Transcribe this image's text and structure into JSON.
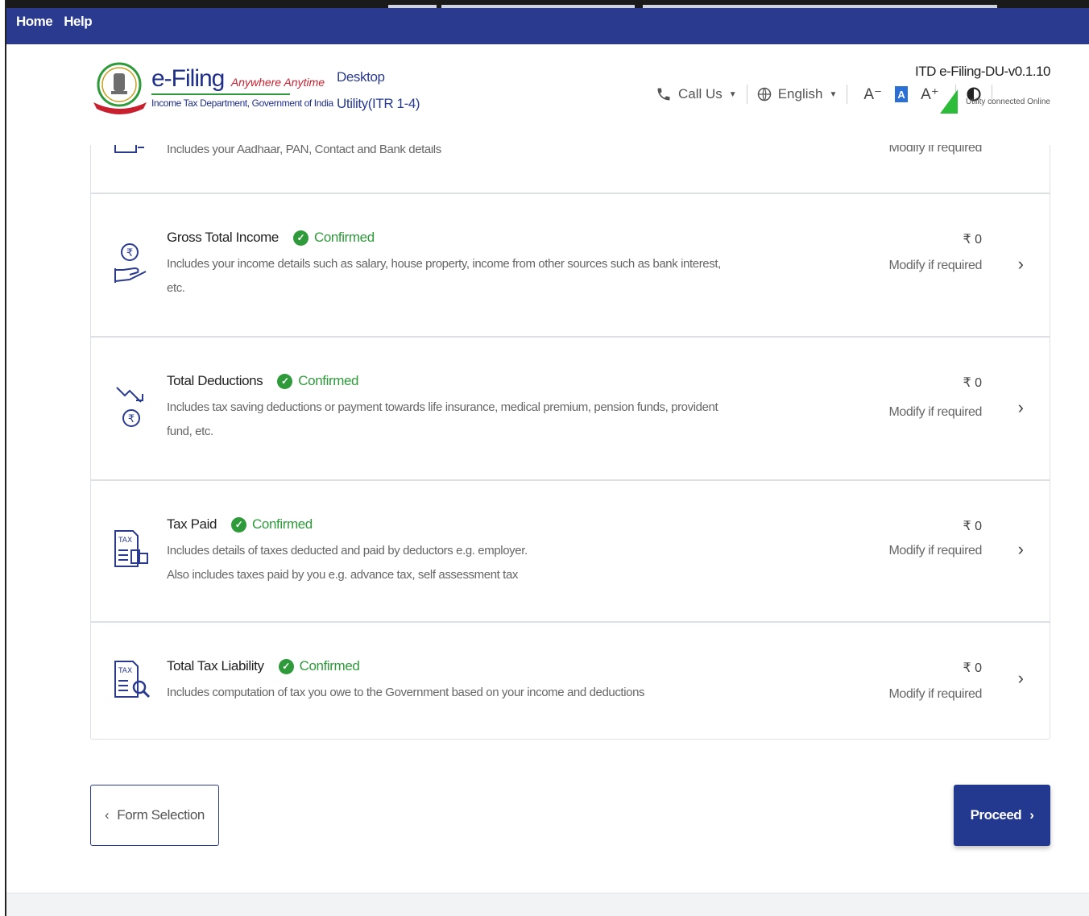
{
  "menubar": {
    "home": "Home",
    "help": "Help"
  },
  "brand": {
    "title": "e-Filing",
    "tagline": "Anywhere Anytime",
    "subtitle": "Income Tax Department, Government of India"
  },
  "app": {
    "line1": "Desktop",
    "line2": "Utility(ITR 1-4)"
  },
  "toolbar": {
    "call_us": "Call Us",
    "language": "English",
    "font_decrease": "A⁻",
    "font_normal": "A",
    "font_increase": "A⁺"
  },
  "version": "ITD e-Filing-DU-v0.1.10",
  "connection_status": "Utility connected Online",
  "partial_row": {
    "desc": "Includes your Aadhaar, PAN, Contact and Bank details",
    "modify": "Modify if required"
  },
  "rows": [
    {
      "title": "Gross Total Income",
      "status": "Confirmed",
      "desc1": "Includes your income details such as salary, house property, income from other sources such as bank interest,",
      "desc2": "etc.",
      "amount": "₹ 0",
      "modify": "Modify if required"
    },
    {
      "title": "Total Deductions",
      "status": "Confirmed",
      "desc1": "Includes tax saving deductions or payment towards life insurance, medical premium, pension funds, provident",
      "desc2": "fund, etc.",
      "amount": "₹ 0",
      "modify": "Modify if required"
    },
    {
      "title": "Tax Paid",
      "status": "Confirmed",
      "desc1": "Includes details of taxes deducted and paid by deductors e.g. employer.",
      "desc2": "Also includes taxes paid by you e.g. advance tax, self assessment tax",
      "amount": "₹ 0",
      "modify": "Modify if required"
    },
    {
      "title": "Total Tax Liability",
      "status": "Confirmed",
      "desc1": "Includes computation of tax you owe to the Government based on your income and deductions",
      "desc2": "",
      "amount": "₹ 0",
      "modify": "Modify if required"
    }
  ],
  "buttons": {
    "back": "Form Selection",
    "proceed": "Proceed"
  },
  "colors": {
    "primary": "#2a3b8f",
    "confirmed": "#2e9a3a"
  }
}
